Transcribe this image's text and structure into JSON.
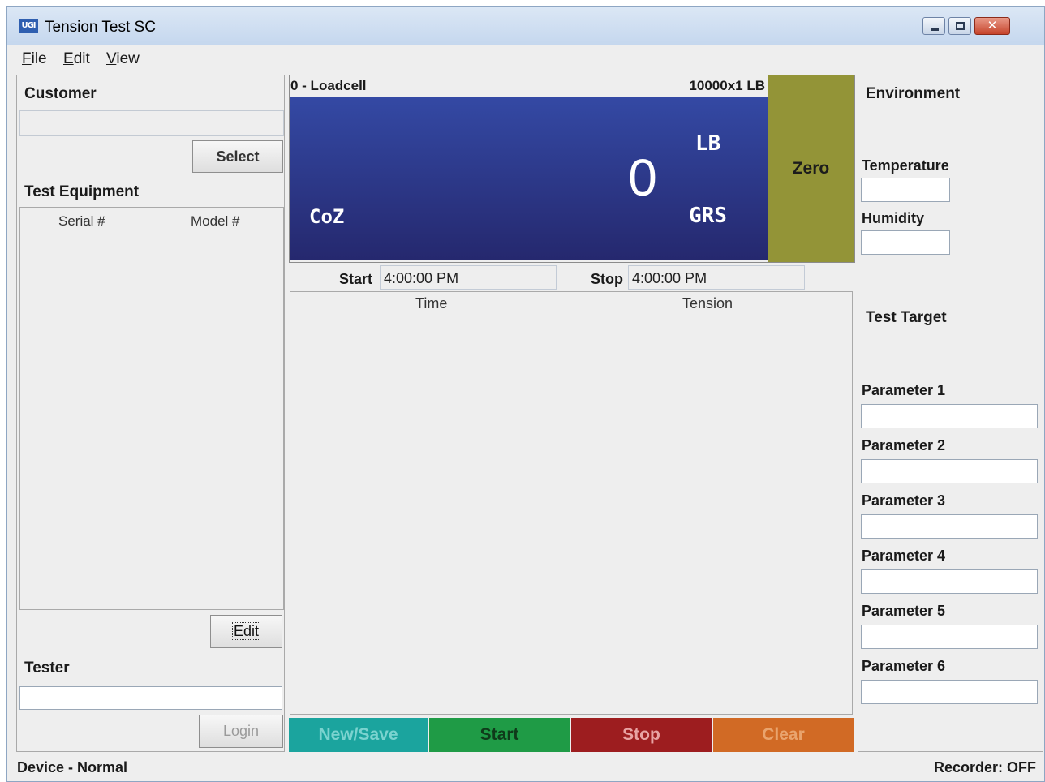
{
  "window": {
    "title": "Tension Test SC",
    "icon": "app-logo-icon",
    "icon_text": "UGI"
  },
  "menu": [
    "File",
    "Edit",
    "View"
  ],
  "left": {
    "customer_label": "Customer",
    "customer_value": "",
    "select_label": "Select",
    "equipment_label": "Test Equipment",
    "columns": [
      "Serial #",
      "Model #"
    ],
    "edit_label": "Edit",
    "tester_label": "Tester",
    "tester_value": "",
    "login_label": "Login"
  },
  "display": {
    "loadcell": "0 - Loadcell",
    "capacity": "10000x1 LB",
    "unit": "LB",
    "reading": "0",
    "mode": "GRS",
    "coz": "CoZ",
    "zero_label": "Zero"
  },
  "times": {
    "start_label": "Start",
    "start_value": "4:00:00 PM",
    "stop_label": "Stop",
    "stop_value": "4:00:00 PM"
  },
  "data_table": {
    "columns": [
      "Time",
      "Tension"
    ]
  },
  "actions": [
    {
      "label": "New/Save",
      "color": "#1ba49e"
    },
    {
      "label": "Start",
      "color": "#1f9b46"
    },
    {
      "label": "Stop",
      "color": "#9d1d1f"
    },
    {
      "label": "Clear",
      "color": "#d16a25"
    }
  ],
  "environment": {
    "title": "Environment",
    "temperature_label": "Temperature",
    "humidity_label": "Humidity",
    "test_target_label": "Test Target",
    "parameters": [
      "Parameter 1",
      "Parameter 2",
      "Parameter 3",
      "Parameter 4",
      "Parameter 5",
      "Parameter 6"
    ]
  },
  "status": {
    "left": "Device - Normal",
    "right": "Recorder: OFF"
  }
}
